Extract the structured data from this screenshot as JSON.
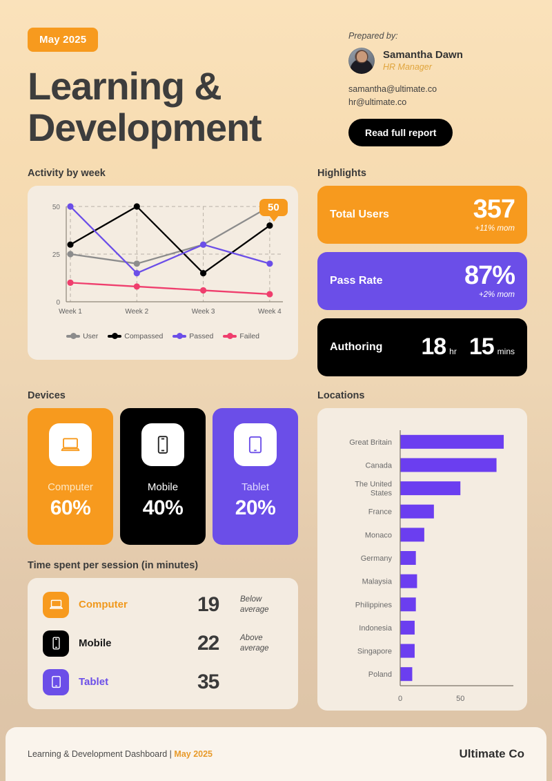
{
  "header": {
    "badge": "May 2025",
    "title_line1": "Learning &",
    "title_line2": "Development",
    "prepared_label": "Prepared by:",
    "person_name": "Samantha Dawn",
    "person_role": "HR Manager",
    "email_1": "samantha@ultimate.co",
    "email_2": "hr@ultimate.co",
    "cta_label": "Read full report"
  },
  "sections": {
    "activity": "Activity by week",
    "highlights": "Highlights",
    "devices": "Devices",
    "locations": "Locations",
    "time_spent": "Time spent per session (in minutes)"
  },
  "chart_data": [
    {
      "type": "line",
      "title": "Activity by week",
      "categories": [
        "Week 1",
        "Week 2",
        "Week 3",
        "Week 4"
      ],
      "xlabel": "",
      "ylabel": "",
      "ylim": [
        0,
        50
      ],
      "yticks": [
        0,
        25,
        50
      ],
      "grid": true,
      "legend_position": "bottom",
      "annotation": {
        "label": "50",
        "series": "User",
        "category": "Week 4",
        "value": 50
      },
      "series": [
        {
          "name": "User",
          "color": "#8c8c8c",
          "values": [
            25,
            20,
            30,
            50
          ]
        },
        {
          "name": "Compassed",
          "color": "#000000",
          "values": [
            30,
            50,
            15,
            40
          ]
        },
        {
          "name": "Passed",
          "color": "#6b4ee8",
          "values": [
            50,
            15,
            30,
            20
          ]
        },
        {
          "name": "Failed",
          "color": "#ef3e6d",
          "values": [
            10,
            8,
            6,
            4
          ]
        }
      ]
    },
    {
      "type": "bar",
      "orientation": "horizontal",
      "title": "Locations",
      "categories": [
        "Great Britain",
        "Canada",
        "The United States",
        "France",
        "Monaco",
        "Germany",
        "Malaysia",
        "Philippines",
        "Indonesia",
        "Singapore",
        "Poland"
      ],
      "values": [
        86,
        80,
        50,
        28,
        20,
        13,
        14,
        13,
        12,
        12,
        10
      ],
      "color": "#6b3ef0",
      "xlim": [
        0,
        94
      ],
      "xticks": [
        0,
        50
      ],
      "xtick_labels": [
        "0",
        "50"
      ],
      "grid": false,
      "legend_position": "none"
    }
  ],
  "highlights": [
    {
      "label": "Total Users",
      "value": "357",
      "delta": "+11% mom",
      "bg": "#f79a1e",
      "delta_color": "#ffffff"
    },
    {
      "label": "Pass Rate",
      "value": "87%",
      "delta": "+2% mom",
      "bg": "#6b4ee8",
      "delta_color": "#ffffff"
    },
    {
      "label": "Authoring",
      "hours": "18",
      "hours_unit": "hr",
      "minutes": "15",
      "minutes_unit": "mins",
      "bg": "#000000"
    }
  ],
  "devices": [
    {
      "icon": "laptop-icon",
      "name": "Computer",
      "percent": "60%",
      "bg": "#f79a1e",
      "name_color": "#fde8c6",
      "icon_color": "#f79a1e"
    },
    {
      "icon": "phone-icon",
      "name": "Mobile",
      "percent": "40%",
      "bg": "#000000",
      "name_color": "#ffffff",
      "icon_color": "#222222"
    },
    {
      "icon": "tablet-icon",
      "name": "Tablet",
      "percent": "20%",
      "bg": "#6b4ee8",
      "name_color": "#e0daff",
      "icon_color": "#6b4ee8"
    }
  ],
  "time_spent": [
    {
      "icon": "laptop-icon",
      "name": "Computer",
      "value": "19",
      "note": "Below average",
      "bg": "#f79a1e",
      "label_color": "#f0981c"
    },
    {
      "icon": "phone-icon",
      "name": "Mobile",
      "value": "22",
      "note": "Above average",
      "bg": "#000000",
      "label_color": "#1a1a1a"
    },
    {
      "icon": "tablet-icon",
      "name": "Tablet",
      "value": "35",
      "note": "",
      "bg": "#6b4ee8",
      "label_color": "#6b4ee8"
    }
  ],
  "footer": {
    "text": "Learning & Development Dashboard | ",
    "highlight": "May 2025",
    "brand": "Ultimate Co"
  }
}
